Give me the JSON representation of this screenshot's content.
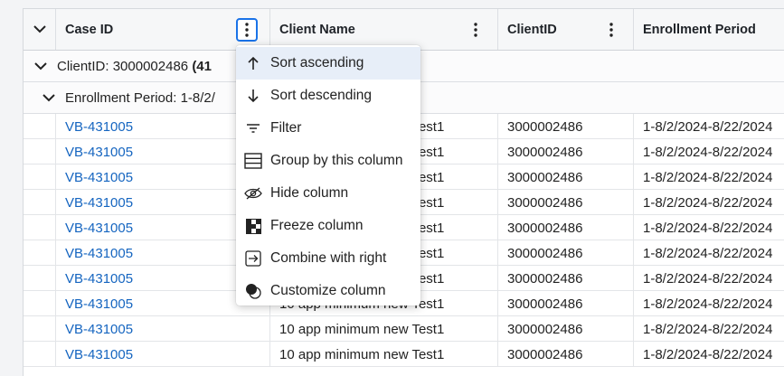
{
  "columns": [
    {
      "label": "Case ID"
    },
    {
      "label": "Client Name"
    },
    {
      "label": "ClientID"
    },
    {
      "label": "Enrollment Period"
    }
  ],
  "groups": {
    "level1": {
      "prefix": "ClientID:",
      "value": "3000002486",
      "count": "(41"
    },
    "level2": {
      "prefix": "Enrollment Period:",
      "value": "1-8/2/"
    }
  },
  "rows": [
    {
      "case_id": "VB-431005",
      "client_name": "10 app minimum new Test1",
      "client_id": "3000002486",
      "enrollment": "1-8/2/2024-8/22/2024"
    },
    {
      "case_id": "VB-431005",
      "client_name": "10 app minimum new Test1",
      "client_id": "3000002486",
      "enrollment": "1-8/2/2024-8/22/2024"
    },
    {
      "case_id": "VB-431005",
      "client_name": "10 app minimum new Test1",
      "client_id": "3000002486",
      "enrollment": "1-8/2/2024-8/22/2024"
    },
    {
      "case_id": "VB-431005",
      "client_name": "10 app minimum new Test1",
      "client_id": "3000002486",
      "enrollment": "1-8/2/2024-8/22/2024"
    },
    {
      "case_id": "VB-431005",
      "client_name": "10 app minimum new Test1",
      "client_id": "3000002486",
      "enrollment": "1-8/2/2024-8/22/2024"
    },
    {
      "case_id": "VB-431005",
      "client_name": "10 app minimum new Test1",
      "client_id": "3000002486",
      "enrollment": "1-8/2/2024-8/22/2024"
    },
    {
      "case_id": "VB-431005",
      "client_name": "10 app minimum new Test1",
      "client_id": "3000002486",
      "enrollment": "1-8/2/2024-8/22/2024"
    },
    {
      "case_id": "VB-431005",
      "client_name": "10 app minimum new Test1",
      "client_id": "3000002486",
      "enrollment": "1-8/2/2024-8/22/2024"
    },
    {
      "case_id": "VB-431005",
      "client_name": "10 app minimum new Test1",
      "client_id": "3000002486",
      "enrollment": "1-8/2/2024-8/22/2024"
    },
    {
      "case_id": "VB-431005",
      "client_name": "10 app minimum new Test1",
      "client_id": "3000002486",
      "enrollment": "1-8/2/2024-8/22/2024"
    }
  ],
  "column_menu": {
    "items": [
      {
        "label": "Sort ascending",
        "icon": "arrow-up-icon"
      },
      {
        "label": "Sort descending",
        "icon": "arrow-down-icon"
      },
      {
        "label": "Filter",
        "icon": "filter-icon"
      },
      {
        "label": "Group by this column",
        "icon": "group-icon"
      },
      {
        "label": "Hide column",
        "icon": "eye-off-icon"
      },
      {
        "label": "Freeze column",
        "icon": "freeze-icon"
      },
      {
        "label": "Combine with right",
        "icon": "combine-right-icon"
      },
      {
        "label": "Customize column",
        "icon": "customize-icon"
      }
    ]
  },
  "colors": {
    "link": "#1565c0",
    "accent": "#1a73e8",
    "menu_highlight": "#e7eef8"
  }
}
